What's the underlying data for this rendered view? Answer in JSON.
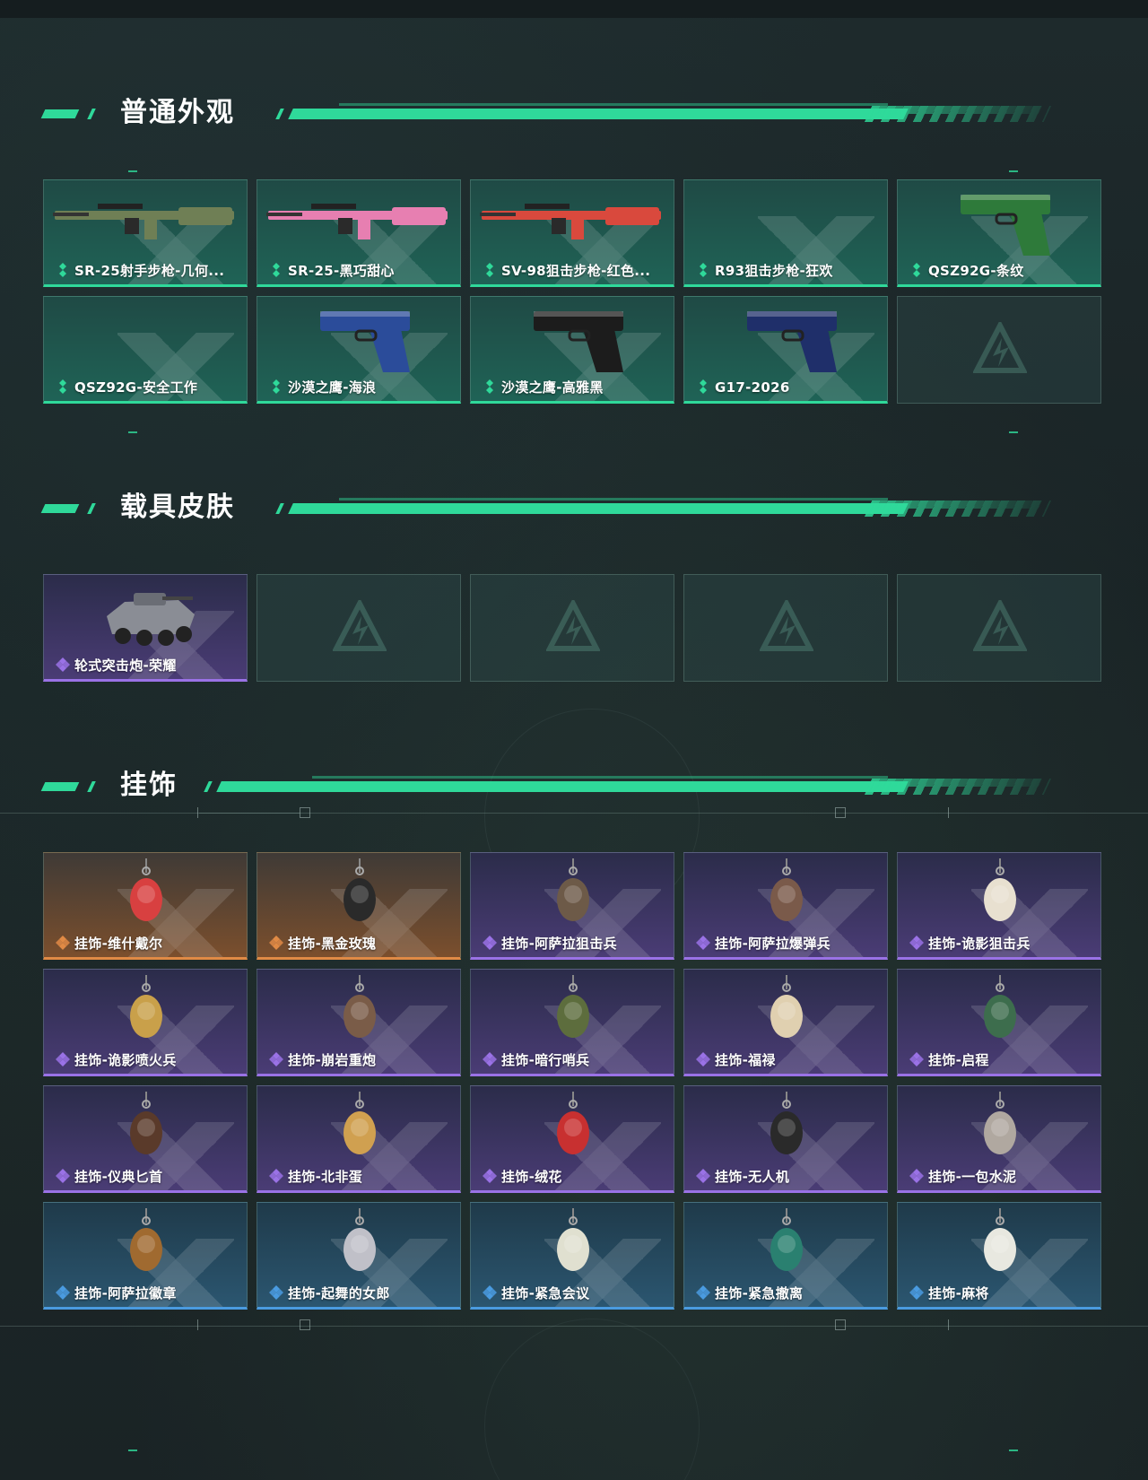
{
  "sections": [
    {
      "title": "普通外观",
      "items": [
        {
          "label": "SR-25射手步枪-几何...",
          "rarity": "green",
          "icon": "rifle-camo-icon",
          "color": "#6f7f55"
        },
        {
          "label": "SR-25-黑巧甜心",
          "rarity": "green",
          "icon": "rifle-pink-icon",
          "color": "#e77fb1"
        },
        {
          "label": "SV-98狙击步枪-红色...",
          "rarity": "green",
          "icon": "sniper-red-icon",
          "color": "#d9493d"
        },
        {
          "label": "R93狙击步枪-狂欢",
          "rarity": "green",
          "icon": "",
          "color": ""
        },
        {
          "label": "QSZ92G-条纹",
          "rarity": "green",
          "icon": "pistol-green-icon",
          "color": "#2e7a3a"
        },
        {
          "label": "QSZ92G-安全工作",
          "rarity": "green",
          "icon": "",
          "color": ""
        },
        {
          "label": "沙漠之鹰-海浪",
          "rarity": "green",
          "icon": "pistol-blue-icon",
          "color": "#2b4c9a"
        },
        {
          "label": "沙漠之鹰-高雅黑",
          "rarity": "green",
          "icon": "pistol-black-icon",
          "color": "#1c1c1c"
        },
        {
          "label": "G17-2026",
          "rarity": "green",
          "icon": "pistol-navy-icon",
          "color": "#1f2f6a"
        },
        {
          "label": "",
          "rarity": "empty",
          "icon": "",
          "color": ""
        }
      ]
    },
    {
      "title": "载具皮肤",
      "items": [
        {
          "label": "轮式突击炮-荣耀",
          "rarity": "purple",
          "icon": "armored-vehicle-icon",
          "color": "#8a8d95"
        },
        {
          "label": "",
          "rarity": "empty",
          "icon": "",
          "color": ""
        },
        {
          "label": "",
          "rarity": "empty",
          "icon": "",
          "color": ""
        },
        {
          "label": "",
          "rarity": "empty",
          "icon": "",
          "color": ""
        },
        {
          "label": "",
          "rarity": "empty",
          "icon": "",
          "color": ""
        }
      ]
    },
    {
      "title": "挂饰",
      "items": [
        {
          "label": "挂饰-维什戴尔",
          "rarity": "orange",
          "icon": "charm-icon",
          "color": "#d84040"
        },
        {
          "label": "挂饰-黑金玫瑰",
          "rarity": "orange",
          "icon": "charm-icon",
          "color": "#2a2a2a"
        },
        {
          "label": "挂饰-阿萨拉狙击兵",
          "rarity": "purple",
          "icon": "charm-icon",
          "color": "#6d5a48"
        },
        {
          "label": "挂饰-阿萨拉爆弹兵",
          "rarity": "purple",
          "icon": "charm-icon",
          "color": "#7a5a4a"
        },
        {
          "label": "挂饰-诡影狙击兵",
          "rarity": "purple",
          "icon": "charm-icon",
          "color": "#e8e0d0"
        },
        {
          "label": "挂饰-诡影喷火兵",
          "rarity": "purple",
          "icon": "charm-icon",
          "color": "#c9a04a"
        },
        {
          "label": "挂饰-崩岩重炮",
          "rarity": "purple",
          "icon": "charm-icon",
          "color": "#7a5c48"
        },
        {
          "label": "挂饰-暗行哨兵",
          "rarity": "purple",
          "icon": "charm-icon",
          "color": "#5d6d3d"
        },
        {
          "label": "挂饰-福禄",
          "rarity": "purple",
          "icon": "charm-icon",
          "color": "#e0d0b0"
        },
        {
          "label": "挂饰-启程",
          "rarity": "purple",
          "icon": "charm-icon",
          "color": "#3d6d4d"
        },
        {
          "label": "挂饰-仪典匕首",
          "rarity": "purple",
          "icon": "charm-icon",
          "color": "#5a3a2a"
        },
        {
          "label": "挂饰-北非蛋",
          "rarity": "purple",
          "icon": "charm-icon",
          "color": "#d0a050"
        },
        {
          "label": "挂饰-绒花",
          "rarity": "purple",
          "icon": "charm-icon",
          "color": "#c83030"
        },
        {
          "label": "挂饰-无人机",
          "rarity": "purple",
          "icon": "charm-icon",
          "color": "#2a2a2a"
        },
        {
          "label": "挂饰-一包水泥",
          "rarity": "purple",
          "icon": "charm-icon",
          "color": "#b0a8a0"
        },
        {
          "label": "挂饰-阿萨拉徽章",
          "rarity": "blue",
          "icon": "charm-icon",
          "color": "#a06a30"
        },
        {
          "label": "挂饰-起舞的女郎",
          "rarity": "blue",
          "icon": "charm-icon",
          "color": "#c0c0c8"
        },
        {
          "label": "挂饰-紧急会议",
          "rarity": "blue",
          "icon": "charm-icon",
          "color": "#e0e0d0"
        },
        {
          "label": "挂饰-紧急撤离",
          "rarity": "blue",
          "icon": "charm-icon",
          "color": "#2a8070"
        },
        {
          "label": "挂饰-麻将",
          "rarity": "blue",
          "icon": "charm-icon",
          "color": "#e8e8e0"
        }
      ]
    }
  ],
  "colors": {
    "accent": "#2fd99a",
    "green_rarity": "#2fd99a",
    "purple_rarity": "#9a72e6",
    "orange_rarity": "#e08a45",
    "blue_rarity": "#4a9be0"
  }
}
